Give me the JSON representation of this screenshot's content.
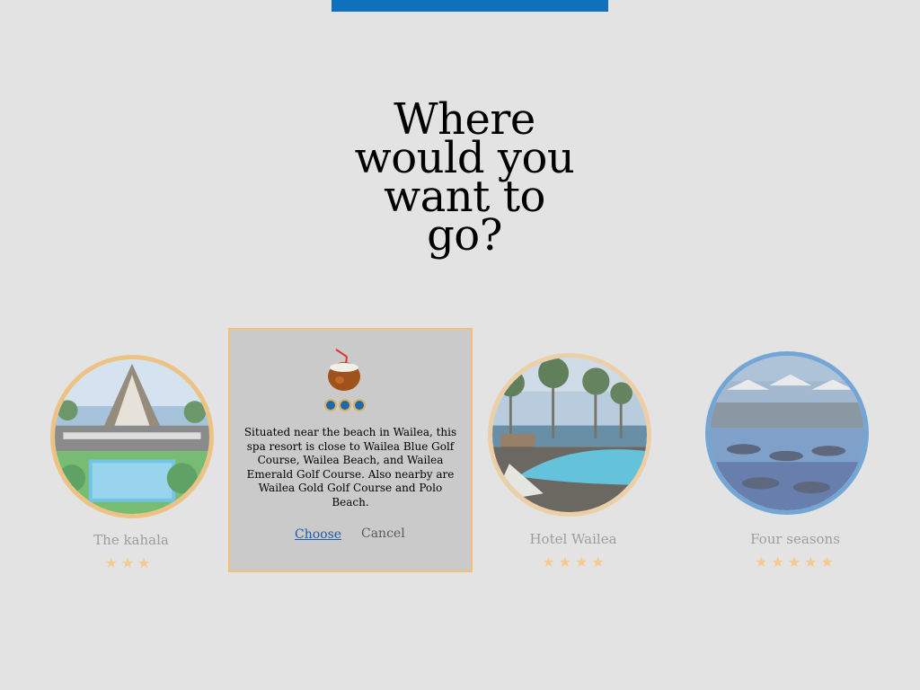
{
  "headline": {
    "lines": [
      "Where",
      "would you",
      "want to",
      "go?"
    ]
  },
  "hotels": [
    {
      "name": "The kahala",
      "stars": 3,
      "star_glyphs": "★★★",
      "ring_color": "#f0b860"
    },
    {
      "name": "Hotel Wailea",
      "stars": 4,
      "star_glyphs": "★★★★",
      "ring_color": "#f0c890"
    },
    {
      "name": "Four seasons",
      "stars": 5,
      "star_glyphs": "★★★★★",
      "ring_color": "#4a8fd0"
    }
  ],
  "popup": {
    "icon": "coconut-drink-icon",
    "description": "Situated near the beach in Wailea, this spa resort is close to Wailea Blue Golf Course, Wailea Beach, and Wailea Emerald Golf Course. Also nearby are Wailea Gold Golf Course and Polo Beach.",
    "choose_label": "Choose",
    "cancel_label": "Cancel"
  },
  "colors": {
    "accent": "#0f71bb",
    "popup_border": "#f3c07c",
    "star": "#f5c98f",
    "link": "#1d5ca8"
  }
}
